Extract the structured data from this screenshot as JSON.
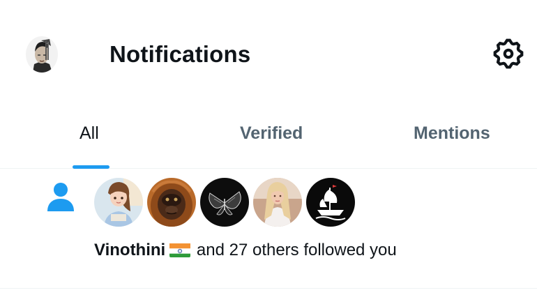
{
  "header": {
    "title": "Notifications",
    "profile_avatar": "user-avatar",
    "settings_icon": "gear-icon"
  },
  "tabs": [
    {
      "label": "All",
      "active": true
    },
    {
      "label": "Verified",
      "active": false
    },
    {
      "label": "Mentions",
      "active": false
    }
  ],
  "notification": {
    "type_icon": "person-icon",
    "user_name": "Vinothini",
    "flag_icon": "india-flag-icon",
    "message": "and 27 others followed you",
    "avatars": [
      {
        "name": "cartoon-girl-avatar"
      },
      {
        "name": "orangutan-avatar"
      },
      {
        "name": "butterfly-avatar"
      },
      {
        "name": "blonde-woman-avatar"
      },
      {
        "name": "ship-logo-avatar"
      }
    ]
  },
  "colors": {
    "accent": "#1d9bf0",
    "text_primary": "#0f1419",
    "text_secondary": "#536471",
    "divider": "#eff3f4"
  }
}
